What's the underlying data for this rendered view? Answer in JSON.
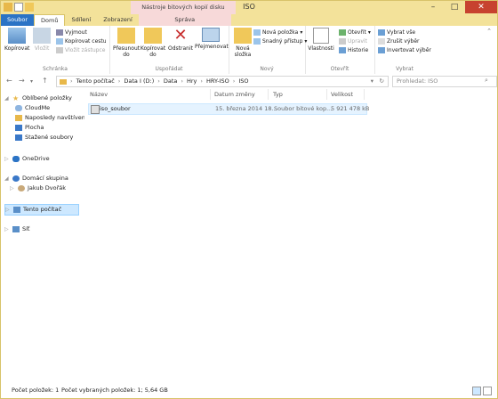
{
  "window": {
    "title": "ISO",
    "context_tab_title": "Nástroje bitových kopií disku"
  },
  "tabs": [
    {
      "label": "Soubor"
    },
    {
      "label": "Domů"
    },
    {
      "label": "Sdílení"
    },
    {
      "label": "Zobrazení"
    },
    {
      "label": "Správa"
    }
  ],
  "ribbon": {
    "clipboard": {
      "label": "Schránka",
      "copy": "Kopírovat",
      "paste": "Vložit",
      "cut": "Vyjmout",
      "copy_path": "Kopírovat cestu",
      "paste_shortcut": "Vložit zástupce"
    },
    "organize": {
      "label": "Uspořádat",
      "move_to": "Přesunout do",
      "copy_to": "Kopírovat do",
      "delete": "Odstranit",
      "rename": "Přejmenovat"
    },
    "new": {
      "label": "Nový",
      "new_folder": "Nová složka",
      "new_item": "Nová položka",
      "easy_access": "Snadný přístup"
    },
    "open": {
      "label": "Otevřít",
      "properties": "Vlastnosti",
      "open": "Otevřít",
      "edit": "Upravit",
      "history": "Historie"
    },
    "select": {
      "label": "Vybrat",
      "select_all": "Vybrat vše",
      "select_none": "Zrušit výběr",
      "invert": "Invertovat výběr"
    }
  },
  "address": {
    "crumbs": [
      "Tento počítač",
      "Data I (D:)",
      "Data",
      "Hry",
      "HRY-ISO",
      "ISO"
    ],
    "search_placeholder": "Prohledat: ISO"
  },
  "nav": {
    "favorites": "Oblíbené položky",
    "fav_items": [
      "CloudMe",
      "Naposledy navštívené",
      "Plocha",
      "Stažené soubory"
    ],
    "onedrive": "OneDrive",
    "homegroup": "Domácí skupina",
    "homegroup_user": "Jakub Dvořák",
    "this_pc": "Tento počítač",
    "network": "Síť"
  },
  "columns": {
    "name": "Název",
    "date": "Datum změny",
    "type": "Typ",
    "size": "Velikost"
  },
  "files": [
    {
      "name": "iso_soubor",
      "date": "15. března 2014 18...",
      "type": "Soubor bitové kop...",
      "size": "5 921 478 kB"
    }
  ],
  "status": {
    "count": "Počet položek: 1",
    "selected": "Počet vybraných položek: 1; 5,64 GB"
  },
  "colors": {
    "accent": "#2b73c5",
    "title_bg": "#f3e29a",
    "context_bg": "#f7d9d9",
    "selection": "#cde8ff"
  }
}
